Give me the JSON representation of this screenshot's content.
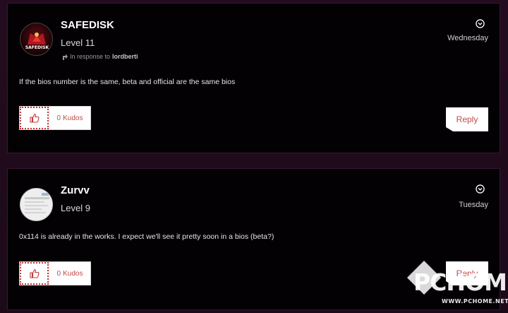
{
  "posts": [
    {
      "username": "SAFEDISK",
      "level": "Level 11",
      "avatar_text": "SAFEDISK",
      "in_response_prefix": "In response to",
      "in_response_user": "lordberti",
      "date": "Wednesday",
      "body": "If the bios number is the same, beta and official are the same bios",
      "kudos_count": "0",
      "kudos_label": "Kudos",
      "reply_label": "Reply"
    },
    {
      "username": "Zurvv",
      "level": "Level 9",
      "date": "Tuesday",
      "body": "0x114 is already in the works. I expect we'll see it pretty soon in a bios (beta?)",
      "kudos_count": "0",
      "kudos_label": "Kudos",
      "reply_label": "Reply"
    }
  ],
  "watermark": {
    "logo": "PCHOME",
    "url": "WWW.PCHOME.NET"
  },
  "colors": {
    "card_bg": "#030103",
    "page_bg": "#1e0b1a",
    "accent": "#c14a4a"
  }
}
